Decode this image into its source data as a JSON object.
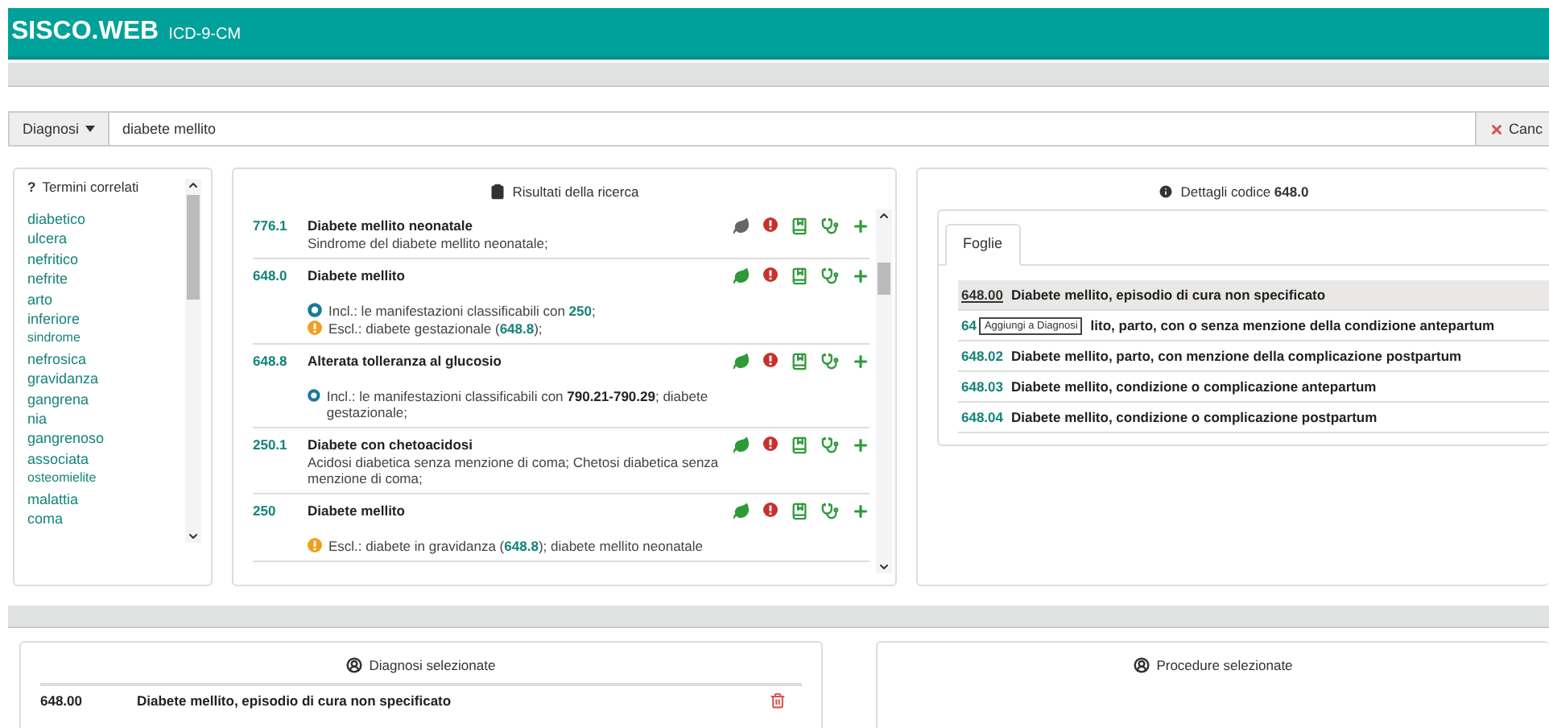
{
  "header": {
    "brand": "SISCO.WEB",
    "subtitle": "ICD-9-CM"
  },
  "search": {
    "category": "Diagnosi",
    "value": "diabete mellito",
    "cancel": "Canc"
  },
  "related_terms": {
    "glyph": "?",
    "title": "Termini correlati",
    "items": [
      "diabetico",
      "ulcera",
      "nefritico",
      "nefrite",
      "arto",
      "inferiore",
      "sindrome",
      "nefrosica",
      "gravidanza",
      "gangrena",
      "nia",
      "gangrenoso",
      "associata",
      "osteomielite",
      "malattia",
      "coma"
    ]
  },
  "results": {
    "title": "Risultati della ricerca",
    "rows": [
      {
        "code": "776.1",
        "title": "Diabete mellito neonatale",
        "description": "Sindrome del diabete mellito neonatale;",
        "leaf_active": false,
        "notes": []
      },
      {
        "code": "648.0",
        "title": "Diabete mellito",
        "leaf_active": true,
        "notes": [
          {
            "kind": "incl",
            "text": "Incl.: le manifestazioni classificabili con **250**;"
          },
          {
            "kind": "escl",
            "text": "Escl.: diabete gestazionale (**648.8**);"
          }
        ]
      },
      {
        "code": "648.8",
        "title": "Alterata tolleranza al glucosio",
        "leaf_active": true,
        "notes": [
          {
            "kind": "incl",
            "text": "Incl.: le manifestazioni classificabili con **790.21-790.29**; diabete gestazionale;"
          }
        ]
      },
      {
        "code": "250.1",
        "title": "Diabete con chetoacidosi",
        "description": "Acidosi diabetica senza menzione di coma; Chetosi diabetica senza menzione di coma;",
        "leaf_active": true,
        "notes": []
      },
      {
        "code": "250",
        "title": "Diabete mellito",
        "leaf_active": true,
        "notes": [
          {
            "kind": "escl",
            "text": "Escl.: diabete in gravidanza (**648.8**); diabete mellito neonatale"
          }
        ]
      }
    ]
  },
  "details": {
    "title": "Dettagli codice",
    "code": "648.0",
    "tabs": [
      {
        "label": "Foglie",
        "selected": true
      }
    ],
    "rows": [
      {
        "code": "648.00",
        "text": "Diabete mellito, episodio di cura non specificato",
        "selected": true
      },
      {
        "code": "64",
        "tooltip": "Aggiungi a Diagnosi",
        "text": "lito, parto, con o senza menzione della condizione antepartum",
        "selected": false
      },
      {
        "code": "648.02",
        "text": "Diabete mellito, parto, con menzione della complicazione postpartum",
        "selected": false
      },
      {
        "code": "648.03",
        "text": "Diabete mellito, condizione o complicazione antepartum",
        "selected": false
      },
      {
        "code": "648.04",
        "text": "Diabete mellito, condizione o complicazione postpartum",
        "selected": false
      }
    ]
  },
  "selected_diagnoses": {
    "title": "Diagnosi selezionate",
    "rows": [
      {
        "code": "648.00",
        "text": "Diabete mellito, episodio di cura non specificato"
      }
    ]
  },
  "selected_procedures": {
    "title": "Procedure selezionate"
  }
}
